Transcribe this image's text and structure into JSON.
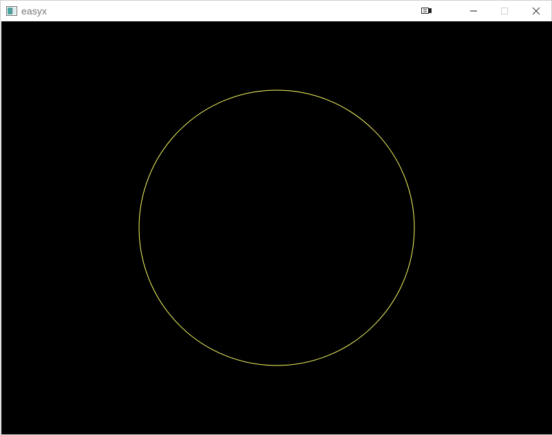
{
  "window": {
    "title": "easyx",
    "canvas_background": "#000000",
    "shape_stroke_color": "#FFFF66"
  },
  "icons": {
    "app": "app-icon",
    "ime": "ime-icon",
    "minimize": "minimize-icon",
    "maximize": "maximize-icon",
    "close": "close-icon"
  }
}
